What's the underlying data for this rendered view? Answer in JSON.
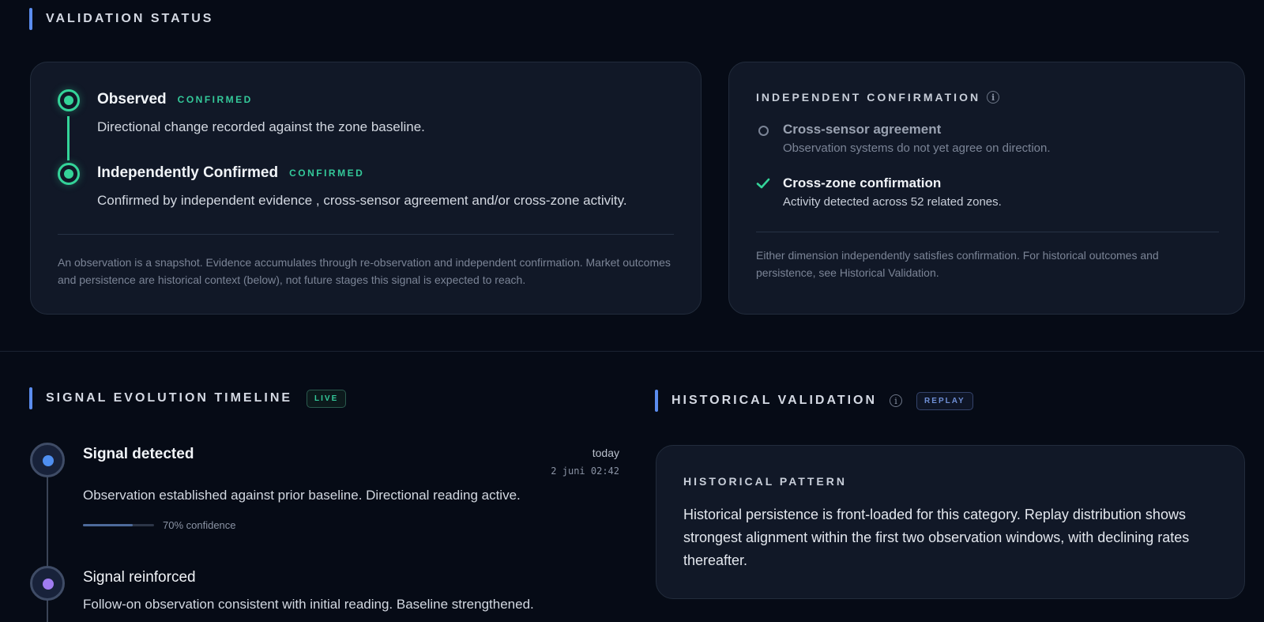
{
  "validation_status": {
    "title": "VALIDATION STATUS",
    "steps": [
      {
        "title": "Observed",
        "badge": "CONFIRMED",
        "description": "Directional change recorded against the zone baseline."
      },
      {
        "title": "Independently Confirmed",
        "badge": "CONFIRMED",
        "description": "Confirmed by independent evidence , cross-sensor agreement and/or cross-zone activity."
      }
    ],
    "footnote": "An observation is a snapshot. Evidence accumulates through re-observation and independent confirmation. Market outcomes and persistence are historical context (below), not future stages this signal is expected to reach."
  },
  "independent_confirmation": {
    "title": "INDEPENDENT CONFIRMATION",
    "info_icon": "i",
    "items": [
      {
        "title": "Cross-sensor agreement",
        "description": "Observation systems do not yet agree on direction.",
        "status": "pending"
      },
      {
        "title": "Cross-zone confirmation",
        "description": "Activity detected across 52 related zones.",
        "status": "met"
      }
    ],
    "footnote": "Either dimension independently satisfies confirmation. For historical outcomes and persistence, see Historical Validation."
  },
  "timeline": {
    "title": "SIGNAL EVOLUTION TIMELINE",
    "badge": "LIVE",
    "events": [
      {
        "title": "Signal detected",
        "day": "today",
        "time": "2 juni 02:42",
        "description": "Observation established against prior baseline. Directional reading active.",
        "confidence_fraction": 0.7,
        "confidence_label": "70% confidence",
        "dot_color": "#4f8ff0"
      },
      {
        "title": "Signal reinforced",
        "description": "Follow-on observation consistent with initial reading. Baseline strengthened.",
        "dot_color": "#a07cf0"
      }
    ]
  },
  "historical_validation": {
    "title": "HISTORICAL VALIDATION",
    "info_icon": "i",
    "badge": "REPLAY",
    "pattern_title": "HISTORICAL PATTERN",
    "pattern_text": "Historical persistence is front-loaded for this category. Replay distribution shows strongest alignment within the first two observation windows, with declining rates thereafter."
  },
  "colors": {
    "accent": "#5b8def",
    "confirmed": "#34d399",
    "background": "#060b16",
    "card": "#111827"
  }
}
